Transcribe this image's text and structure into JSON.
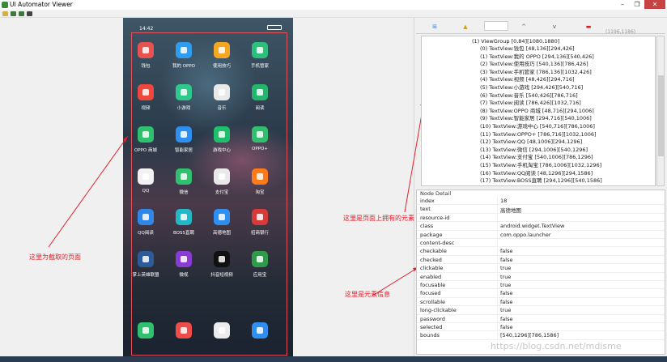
{
  "window": {
    "title": "UI Automator Viewer",
    "controls": [
      "–",
      "❐",
      "✕"
    ]
  },
  "phone": {
    "status_time": "14:42",
    "apps": [
      {
        "label": "钱包",
        "color": "#e8524f"
      },
      {
        "label": "我的 OPPO",
        "color": "#2e9df0"
      },
      {
        "label": "使用技巧",
        "color": "#f5a623"
      },
      {
        "label": "手机管家",
        "color": "#2bc07b"
      },
      {
        "label": "视频",
        "color": "#f0473c"
      },
      {
        "label": "小游戏",
        "color": "#2ec98b"
      },
      {
        "label": "音乐",
        "color": "#e9e9e9"
      },
      {
        "label": "阅读",
        "color": "#25b66d"
      },
      {
        "label": "OPPO 商城",
        "color": "#2fc16e"
      },
      {
        "label": "智能家居",
        "color": "#2f8ff0"
      },
      {
        "label": "游戏中心",
        "color": "#1fbf6d"
      },
      {
        "label": "OPPO+",
        "color": "#2fbf6f"
      },
      {
        "label": "QQ",
        "color": "#f2f2f2"
      },
      {
        "label": "微信",
        "color": "#2fc16e"
      },
      {
        "label": "支付宝",
        "color": "#e9e9e9"
      },
      {
        "label": "淘宝",
        "color": "#ff7a18"
      },
      {
        "label": "QQ阅读",
        "color": "#2f87e9"
      },
      {
        "label": "BOSS直聘",
        "color": "#23b8c8"
      },
      {
        "label": "高德地图",
        "color": "#2f8ff0"
      },
      {
        "label": "招商银行",
        "color": "#d83a3a"
      },
      {
        "label": "掌上英雄联盟",
        "color": "#2c5b9a"
      },
      {
        "label": "微视",
        "color": "#8a3bd1"
      },
      {
        "label": "抖音短视频",
        "color": "#111111"
      },
      {
        "label": "应用宝",
        "color": "#2e9b4a"
      }
    ],
    "dock": [
      {
        "label": "",
        "color": "#2fc16e"
      },
      {
        "label": "",
        "color": "#ee4b4b"
      },
      {
        "label": "",
        "color": "#ececec"
      },
      {
        "label": "",
        "color": "#2f8ff0"
      }
    ]
  },
  "annotations": {
    "left_note": "这里为截取的页面",
    "tree_note": "这里是页面上拥有的元素",
    "detail_note": "这里是元素信息"
  },
  "toolbar_right": {
    "coords": "(1196,1186)"
  },
  "tree": {
    "root": "(1) ViewGroup [0,84][1080,1880]",
    "children": [
      "(0) TextView:钱包 [48,136][294,426]",
      "(1) TextView:我的 OPPO [294,136][540,426]",
      "(2) TextView:使用技巧 [540,136][786,426]",
      "(3) TextView:手机管家 [786,136][1032,426]",
      "(4) TextView:视频 [48,426][294,716]",
      "(5) TextView:小游戏 [294,426][540,716]",
      "(6) TextView:音乐 [540,426][786,716]",
      "(7) TextView:阅读 [786,426][1032,716]",
      "(8) TextView:OPPO 商城 [48,716][294,1006]",
      "(9) TextView:智能家居 [294,716][540,1006]",
      "(10) TextView:游戏中心 [540,716][786,1006]",
      "(11) TextView:OPPO+ [786,716][1032,1006]",
      "(12) TextView:QQ [48,1006][294,1296]",
      "(13) TextView:微信 [294,1006][540,1296]",
      "(14) TextView:支付宝 [540,1006][786,1296]",
      "(15) TextView:手机淘宝 [786,1006][1032,1296]",
      "(16) TextView:QQ阅读 [48,1296][294,1586]",
      "(17) TextView:BOSS直聘 [294,1296][540,1586]"
    ]
  },
  "detail": {
    "header": "Node Detail",
    "rows": [
      {
        "key": "index",
        "value": "18"
      },
      {
        "key": "text",
        "value": "高德地图"
      },
      {
        "key": "resource-id",
        "value": ""
      },
      {
        "key": "class",
        "value": "android.widget.TextView"
      },
      {
        "key": "package",
        "value": "com.oppo.launcher"
      },
      {
        "key": "content-desc",
        "value": ""
      },
      {
        "key": "checkable",
        "value": "false"
      },
      {
        "key": "checked",
        "value": "false"
      },
      {
        "key": "clickable",
        "value": "true"
      },
      {
        "key": "enabled",
        "value": "true"
      },
      {
        "key": "focusable",
        "value": "true"
      },
      {
        "key": "focused",
        "value": "false"
      },
      {
        "key": "scrollable",
        "value": "false"
      },
      {
        "key": "long-clickable",
        "value": "true"
      },
      {
        "key": "password",
        "value": "false"
      },
      {
        "key": "selected",
        "value": "false"
      },
      {
        "key": "bounds",
        "value": "[540,1296][786,1586]"
      }
    ]
  },
  "watermark": "https://blog.csdn.net/mdisme"
}
